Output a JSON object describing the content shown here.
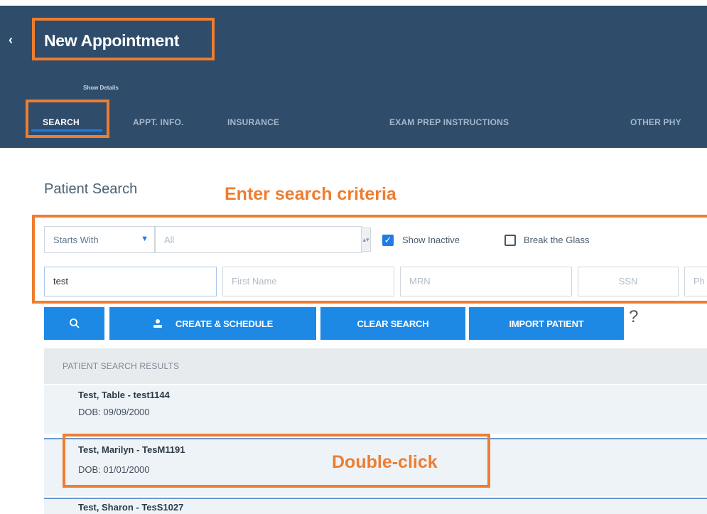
{
  "header": {
    "title": "New Appointment",
    "show_details": "Show Details",
    "tabs": [
      {
        "label": "SEARCH",
        "active": true
      },
      {
        "label": "APPT. INFO."
      },
      {
        "label": "INSURANCE"
      },
      {
        "label": "EXAM PREP INSTRUCTIONS"
      },
      {
        "label": "OTHER PHY"
      }
    ]
  },
  "annotations": {
    "enter_criteria": "Enter search criteria",
    "double_click": "Double-click",
    "color": "#ee7d30"
  },
  "search": {
    "title": "Patient Search",
    "match_mode": "Starts With",
    "scope": "All",
    "show_inactive_label": "Show Inactive",
    "show_inactive_checked": true,
    "break_glass_label": "Break the Glass",
    "break_glass_checked": false,
    "last_name_value": "test",
    "first_name_placeholder": "First Name",
    "mrn_placeholder": "MRN",
    "ssn_placeholder": "SSN",
    "fifth_field_placeholder": "Ph"
  },
  "buttons": {
    "create_schedule": "CREATE & SCHEDULE",
    "clear_search": "CLEAR SEARCH",
    "import_patient": "IMPORT PATIENT",
    "help": "?"
  },
  "results": {
    "header": "PATIENT SEARCH RESULTS",
    "items": [
      {
        "name": "Test, Table - test1144",
        "dob": "DOB: 09/09/2000"
      },
      {
        "name": "Test, Marilyn - TesM1191",
        "dob": "DOB: 01/01/2000"
      },
      {
        "name": "Test, Sharon - TesS1027",
        "dob": ""
      }
    ]
  },
  "colors": {
    "header_bg": "#2f4c6b",
    "accent": "#1e88e5",
    "annotation": "#ee7d30"
  }
}
